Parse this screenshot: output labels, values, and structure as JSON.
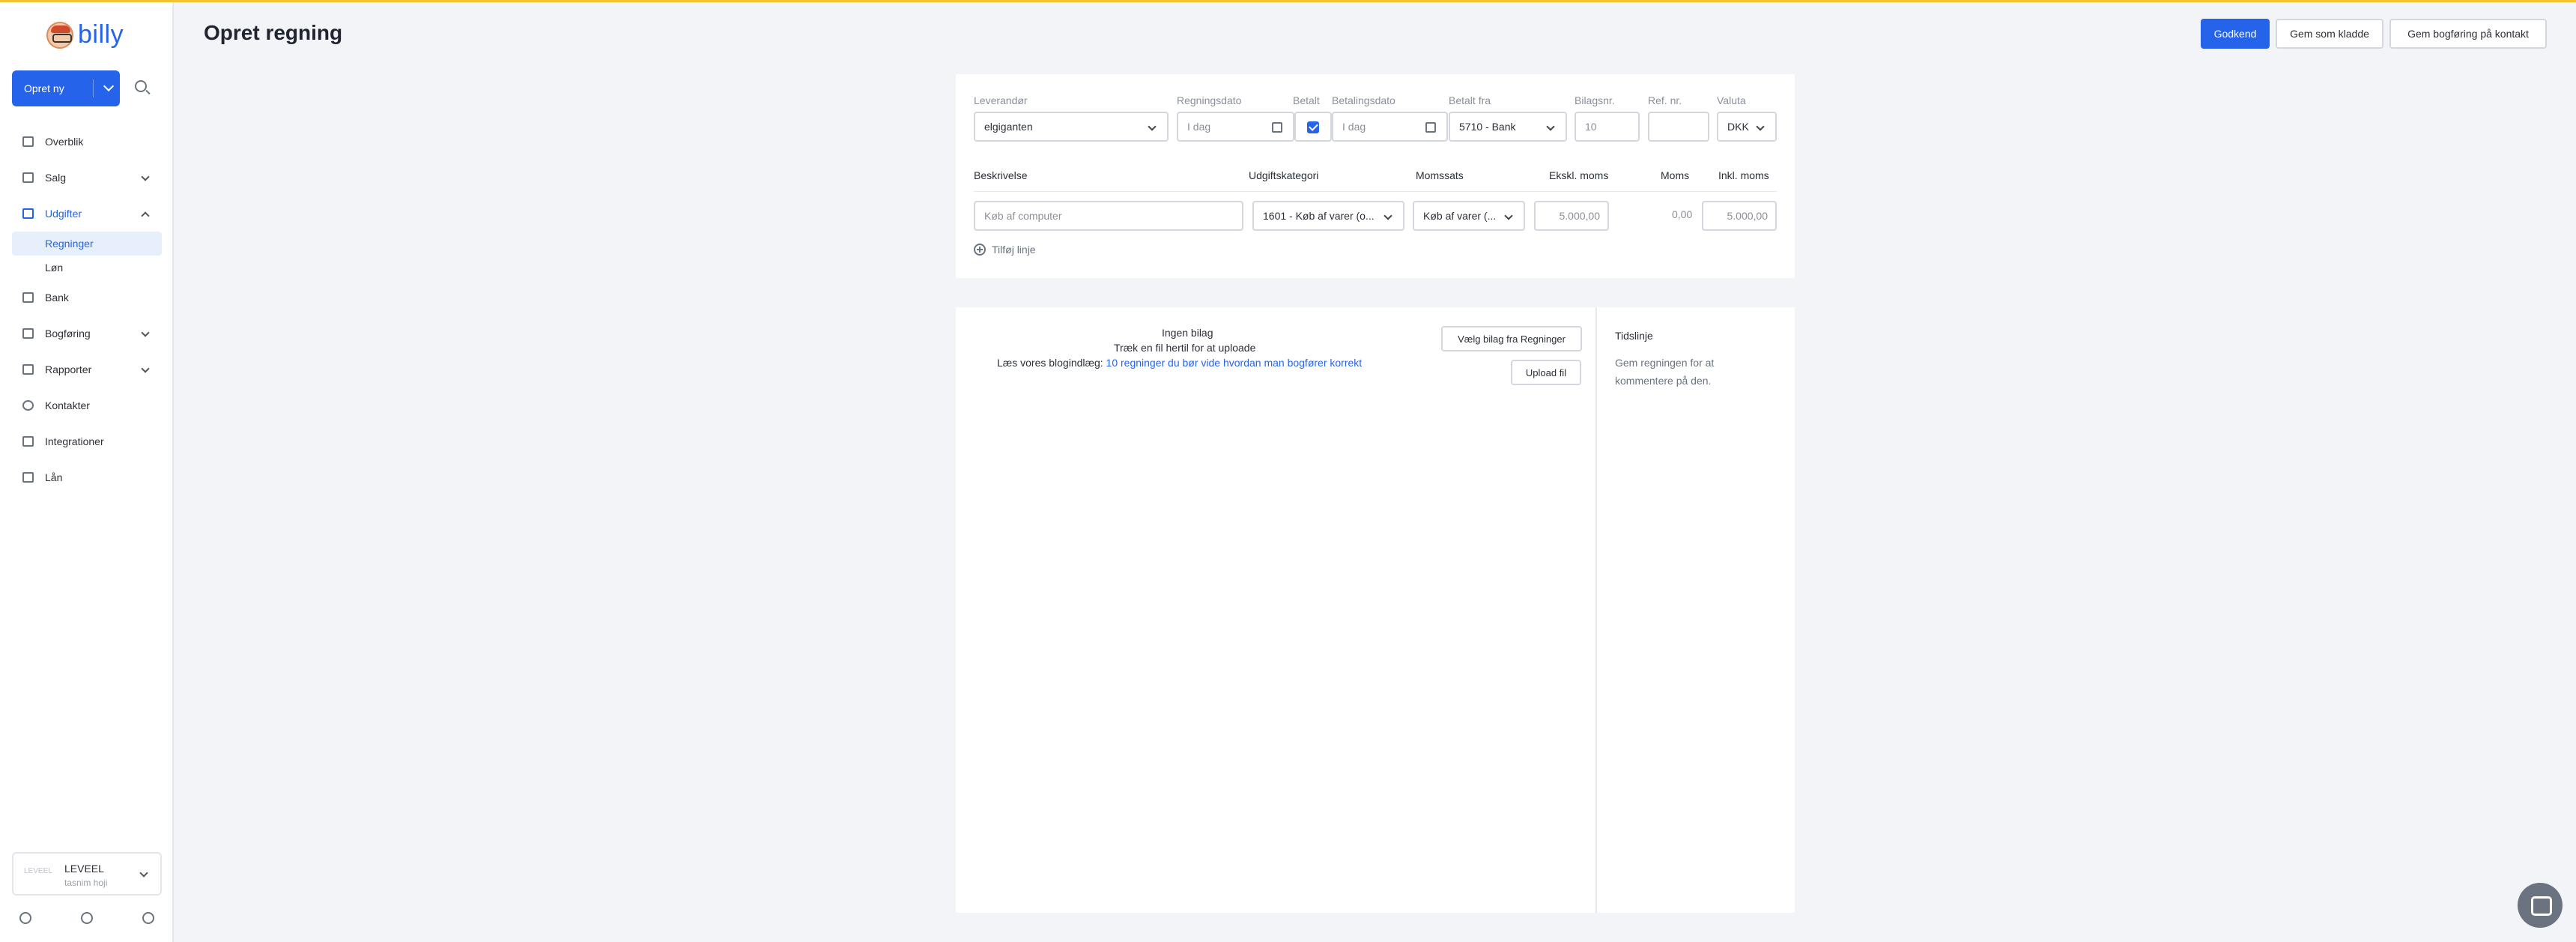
{
  "brand": {
    "name": "billy"
  },
  "sidebar": {
    "create_label": "Opret ny",
    "items": [
      {
        "label": "Overblik"
      },
      {
        "label": "Salg"
      },
      {
        "label": "Udgifter"
      },
      {
        "label": "Regninger"
      },
      {
        "label": "Løn"
      },
      {
        "label": "Bank"
      },
      {
        "label": "Bogføring"
      },
      {
        "label": "Rapporter"
      },
      {
        "label": "Kontakter"
      },
      {
        "label": "Integrationer"
      },
      {
        "label": "Lån"
      }
    ],
    "org": {
      "logo_text": "LEVEEL",
      "name": "LEVEEL",
      "user": "tasnim hoji"
    }
  },
  "header": {
    "title": "Opret regning",
    "approve": "Godkend",
    "save_draft": "Gem som kladde",
    "save_contact": "Gem bogføring på kontakt"
  },
  "bill": {
    "labels": {
      "vendor": "Leverandør",
      "bill_date": "Regningsdato",
      "paid": "Betalt",
      "payment_date": "Betalingsdato",
      "paid_from": "Betalt fra",
      "voucher_no": "Bilagsnr.",
      "ref_no": "Ref. nr.",
      "currency": "Valuta"
    },
    "values": {
      "vendor": "elgiganten",
      "bill_date": "I dag",
      "payment_date": "I dag",
      "paid_from": "5710 - Bank",
      "voucher_no": "10",
      "ref_no": "",
      "currency": "DKK"
    },
    "lines_header": {
      "description": "Beskrivelse",
      "category": "Udgiftskategori",
      "vat_rate": "Momssats",
      "excl_vat": "Ekskl. moms",
      "vat": "Moms",
      "incl_vat": "Inkl. moms"
    },
    "line": {
      "description": "Køb af computer",
      "category": "1601 - Køb af varer (o...",
      "vat_rate": "Køb af varer (...",
      "excl_vat": "5.000,00",
      "vat": "0,00",
      "incl_vat": "5.000,00"
    },
    "add_line": "Tilføj linje"
  },
  "attachment": {
    "none": "Ingen bilag",
    "drag": "Træk en fil hertil for at uploade",
    "read_prefix": "Læs vores blogindlæg:",
    "read_link": "10 regninger du bør vide hvordan man bogfører korrekt",
    "choose_btn": "Vælg bilag fra Regninger",
    "upload_btn": "Upload fil"
  },
  "timeline": {
    "title": "Tidslinje",
    "text": "Gem regningen for at kommentere på den."
  },
  "colors": {
    "primary": "#2563eb",
    "topline": "#f2c230",
    "background": "#f3f4f7"
  }
}
